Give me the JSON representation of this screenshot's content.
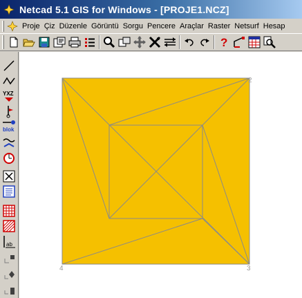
{
  "window": {
    "title": "Netcad 5.1 GIS for Windows - [PROJE1.NCZ]"
  },
  "menu": {
    "items": [
      "Proje",
      "Çiz",
      "Düzenle",
      "Görüntü",
      "Sorgu",
      "Pencere",
      "Araçlar",
      "Raster",
      "Netsurf",
      "Hesap"
    ]
  },
  "toolbar": {
    "icons": [
      "new-file-icon",
      "open-folder-icon",
      "save-icon",
      "save-as-icon",
      "print-icon",
      "layers-list-icon",
      "zoom-icon",
      "zoom-window-icon",
      "pan-icon",
      "cross-icon",
      "arrows-icon",
      "undo-icon",
      "redo-icon",
      "help-icon",
      "line-angle-icon",
      "grid-table-icon",
      "find-icon"
    ]
  },
  "left_toolbar": {
    "icons": [
      "line-tool-icon",
      "polyline-tool-icon",
      "yxz-point-icon",
      "point-marker-icon",
      "blok-tool-icon",
      "curve-tool-icon",
      "circle-tool-icon",
      "select-tool-icon",
      "text-list-icon",
      "hatch-grid-icon",
      "hatch-diagonal-icon",
      "text-ab-icon",
      "scroll-up-icon",
      "diamond-icon",
      "scroll-down-icon"
    ],
    "labels": {
      "yxz": "YXZ",
      "blok": "blok",
      "ab": "ab"
    }
  },
  "drawing": {
    "fill_color": "#f5c000",
    "line_color": "#8a8a8a",
    "point_labels": {
      "bottom_left": "4",
      "bottom_right": "3",
      "top_right": "2"
    }
  }
}
